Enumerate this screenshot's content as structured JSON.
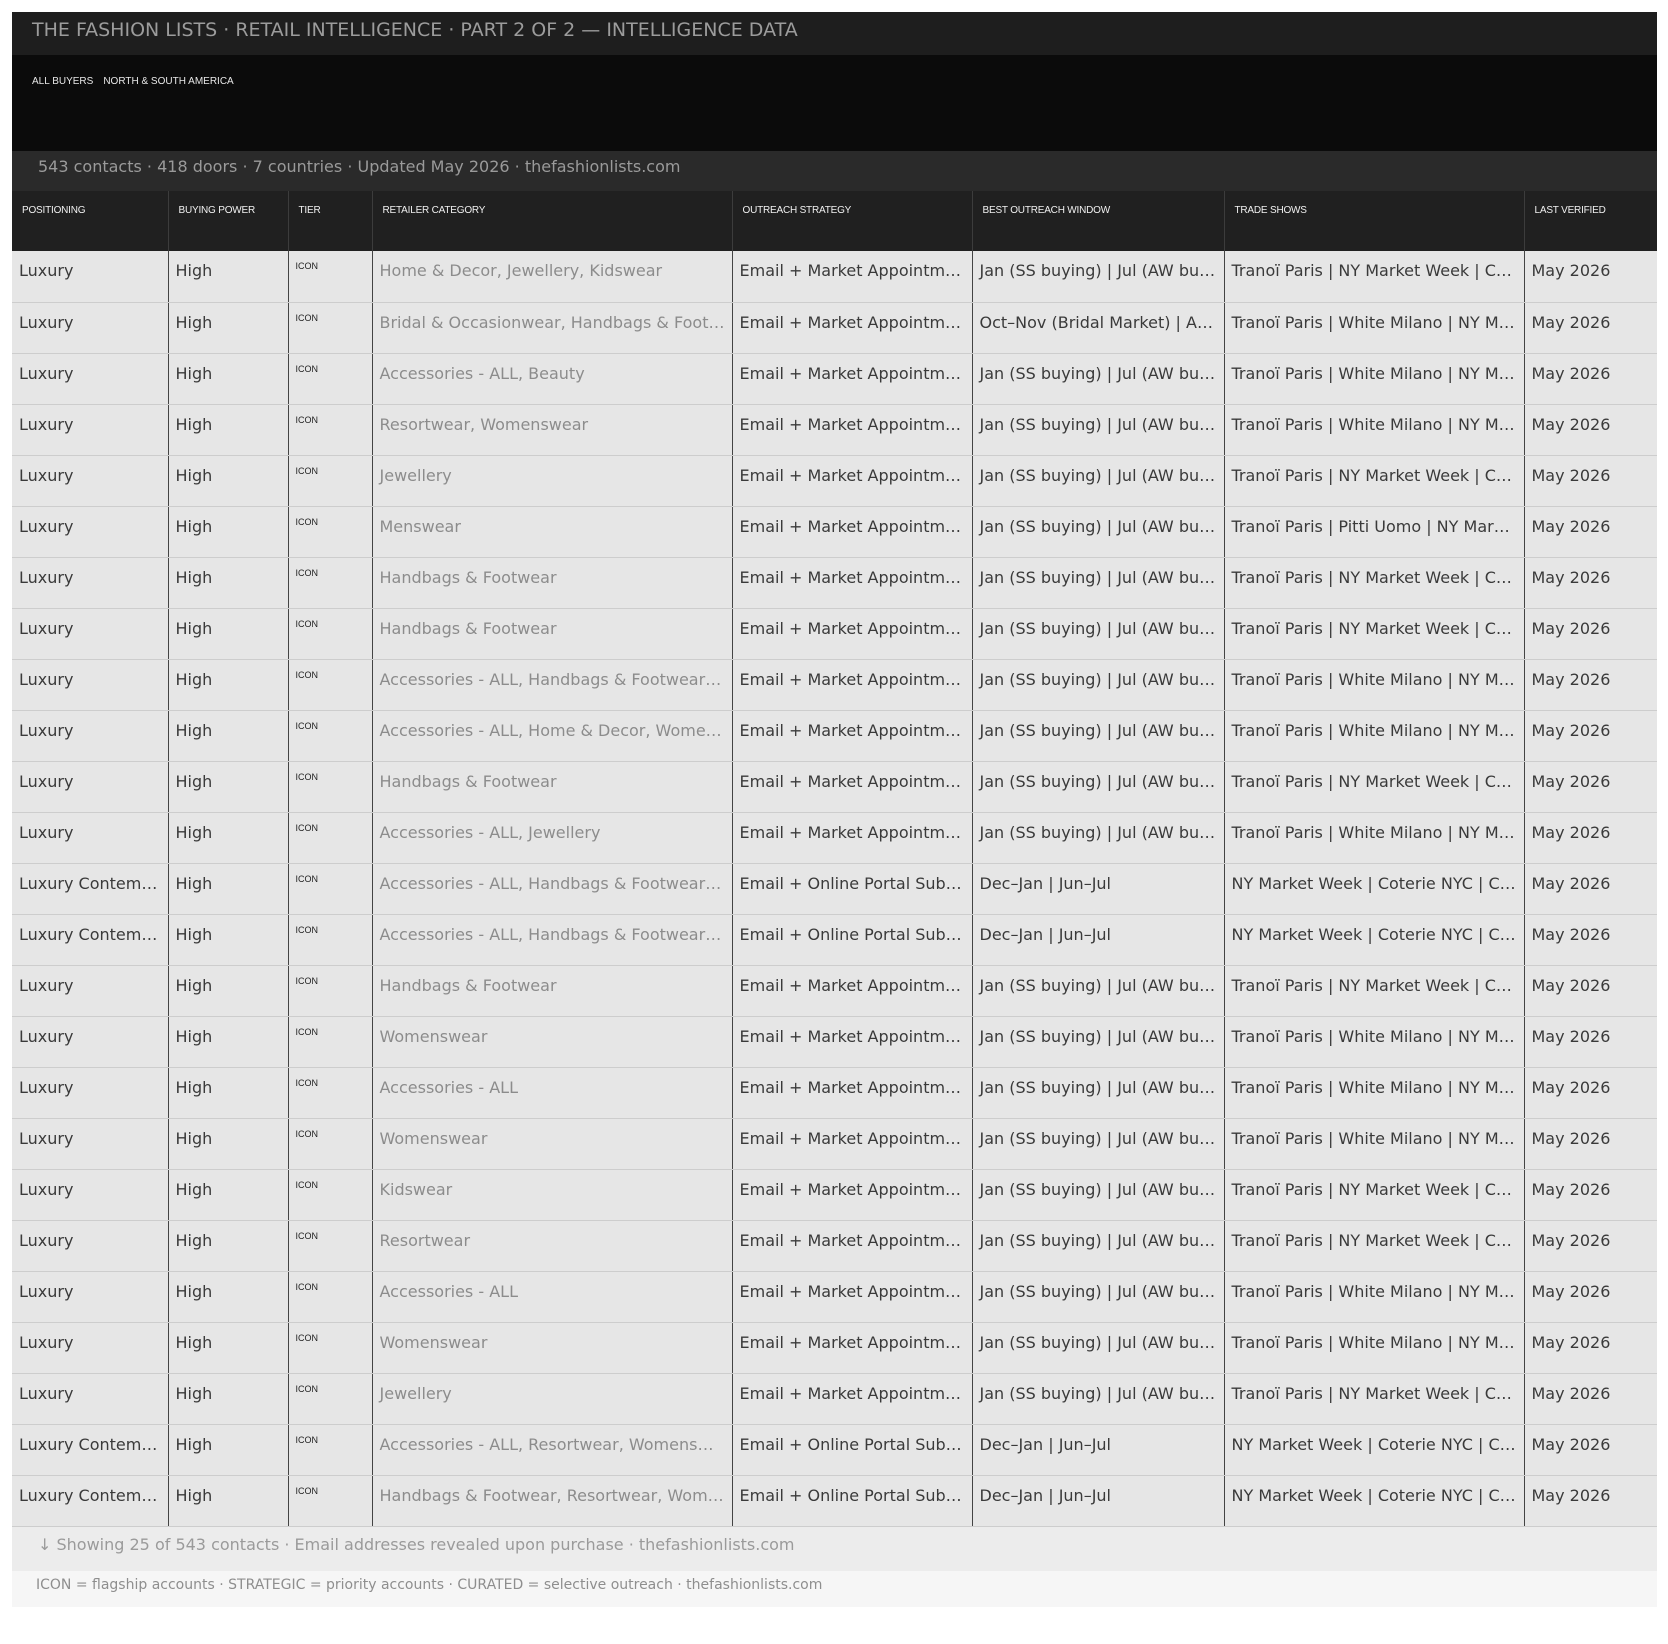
{
  "header": {
    "title": "THE FASHION LISTS  ·  RETAIL INTELLIGENCE  ·  PART 2 OF 2 — INTELLIGENCE DATA",
    "banner_label": "ALL BUYERS NORTH & SOUTH AMERICA",
    "stats": "543 contacts  ·  418 doors  ·  7 countries  ·  Updated May 2026  ·  thefashionlists.com"
  },
  "table": {
    "columns": [
      "Positioning",
      "Buying Power",
      "Tier",
      "Retailer Category",
      "Outreach Strategy",
      "Best Outreach Window",
      "Trade Shows",
      "Last Verified"
    ],
    "rows": [
      [
        "Luxury",
        "High",
        "ICON",
        "Home & Decor, Jewellery, Kidswear",
        "Email + Market Appointments",
        "Jan (SS buying) | Jul (AW buying)",
        "Tranoï Paris | NY Market Week | Coterie NYC",
        "May 2026"
      ],
      [
        "Luxury",
        "High",
        "ICON",
        "Bridal & Occasionwear, Handbags & Footwear",
        "Email + Market Appointments",
        "Oct–Nov (Bridal Market) | Apr–May",
        "Tranoï Paris | White Milano | NY Market Week",
        "May 2026"
      ],
      [
        "Luxury",
        "High",
        "ICON",
        "Accessories - ALL, Beauty",
        "Email + Market Appointments",
        "Jan (SS buying) | Jul (AW buying)",
        "Tranoï Paris | White Milano | NY Market Week",
        "May 2026"
      ],
      [
        "Luxury",
        "High",
        "ICON",
        "Resortwear, Womenswear",
        "Email + Market Appointments",
        "Jan (SS buying) | Jul (AW buying)",
        "Tranoï Paris | White Milano | NY Market Week",
        "May 2026"
      ],
      [
        "Luxury",
        "High",
        "ICON",
        "Jewellery",
        "Email + Market Appointments",
        "Jan (SS buying) | Jul (AW buying)",
        "Tranoï Paris | NY Market Week | Coterie NYC",
        "May 2026"
      ],
      [
        "Luxury",
        "High",
        "ICON",
        "Menswear",
        "Email + Market Appointments",
        "Jan (SS buying) | Jul (AW buying)",
        "Tranoï Paris | Pitti Uomo | NY Market Week",
        "May 2026"
      ],
      [
        "Luxury",
        "High",
        "ICON",
        "Handbags & Footwear",
        "Email + Market Appointments",
        "Jan (SS buying) | Jul (AW buying)",
        "Tranoï Paris | NY Market Week | Coterie NYC",
        "May 2026"
      ],
      [
        "Luxury",
        "High",
        "ICON",
        "Handbags & Footwear",
        "Email + Market Appointments",
        "Jan (SS buying) | Jul (AW buying)",
        "Tranoï Paris | NY Market Week | Coterie NYC",
        "May 2026"
      ],
      [
        "Luxury",
        "High",
        "ICON",
        "Accessories - ALL, Handbags & Footwear, Jewellery",
        "Email + Market Appointments",
        "Jan (SS buying) | Jul (AW buying)",
        "Tranoï Paris | White Milano | NY Market Week",
        "May 2026"
      ],
      [
        "Luxury",
        "High",
        "ICON",
        "Accessories - ALL, Home & Decor, Womenswear",
        "Email + Market Appointments",
        "Jan (SS buying) | Jul (AW buying)",
        "Tranoï Paris | White Milano | NY Market Week",
        "May 2026"
      ],
      [
        "Luxury",
        "High",
        "ICON",
        "Handbags & Footwear",
        "Email + Market Appointments",
        "Jan (SS buying) | Jul (AW buying)",
        "Tranoï Paris | NY Market Week | Coterie NYC",
        "May 2026"
      ],
      [
        "Luxury",
        "High",
        "ICON",
        "Accessories - ALL, Jewellery",
        "Email + Market Appointments",
        "Jan (SS buying) | Jul (AW buying)",
        "Tranoï Paris | White Milano | NY Market Week",
        "May 2026"
      ],
      [
        "Luxury Contemporary",
        "High",
        "ICON",
        "Accessories - ALL, Handbags & Footwear, Womenswear",
        "Email + Online Portal Submission",
        "Dec–Jan | Jun–Jul",
        "NY Market Week | Coterie NYC | Capsule",
        "May 2026"
      ],
      [
        "Luxury Contemporary",
        "High",
        "ICON",
        "Accessories - ALL, Handbags & Footwear, Jewellery",
        "Email + Online Portal Submission",
        "Dec–Jan | Jun–Jul",
        "NY Market Week | Coterie NYC | Capsule",
        "May 2026"
      ],
      [
        "Luxury",
        "High",
        "ICON",
        "Handbags & Footwear",
        "Email + Market Appointments",
        "Jan (SS buying) | Jul (AW buying)",
        "Tranoï Paris | NY Market Week | Coterie NYC",
        "May 2026"
      ],
      [
        "Luxury",
        "High",
        "ICON",
        "Womenswear",
        "Email + Market Appointments",
        "Jan (SS buying) | Jul (AW buying)",
        "Tranoï Paris | White Milano | NY Market Week",
        "May 2026"
      ],
      [
        "Luxury",
        "High",
        "ICON",
        "Accessories - ALL",
        "Email + Market Appointments",
        "Jan (SS buying) | Jul (AW buying)",
        "Tranoï Paris | White Milano | NY Market Week",
        "May 2026"
      ],
      [
        "Luxury",
        "High",
        "ICON",
        "Womenswear",
        "Email + Market Appointments",
        "Jan (SS buying) | Jul (AW buying)",
        "Tranoï Paris | White Milano | NY Market Week",
        "May 2026"
      ],
      [
        "Luxury",
        "High",
        "ICON",
        "Kidswear",
        "Email + Market Appointments",
        "Jan (SS buying) | Jul (AW buying)",
        "Tranoï Paris | NY Market Week | Coterie NYC",
        "May 2026"
      ],
      [
        "Luxury",
        "High",
        "ICON",
        "Resortwear",
        "Email + Market Appointments",
        "Jan (SS buying) | Jul (AW buying)",
        "Tranoï Paris | NY Market Week | Coterie NYC",
        "May 2026"
      ],
      [
        "Luxury",
        "High",
        "ICON",
        "Accessories - ALL",
        "Email + Market Appointments",
        "Jan (SS buying) | Jul (AW buying)",
        "Tranoï Paris | White Milano | NY Market Week",
        "May 2026"
      ],
      [
        "Luxury",
        "High",
        "ICON",
        "Womenswear",
        "Email + Market Appointments",
        "Jan (SS buying) | Jul (AW buying)",
        "Tranoï Paris | White Milano | NY Market Week",
        "May 2026"
      ],
      [
        "Luxury",
        "High",
        "ICON",
        "Jewellery",
        "Email + Market Appointments",
        "Jan (SS buying) | Jul (AW buying)",
        "Tranoï Paris | NY Market Week | Coterie NYC",
        "May 2026"
      ],
      [
        "Luxury Contemporary",
        "High",
        "ICON",
        "Accessories - ALL, Resortwear, Womenswear",
        "Email + Online Portal Submission",
        "Dec–Jan | Jun–Jul",
        "NY Market Week | Coterie NYC | Capsule",
        "May 2026"
      ],
      [
        "Luxury Contemporary",
        "High",
        "ICON",
        "Handbags & Footwear, Resortwear, Womenswear",
        "Email + Online Portal Submission",
        "Dec–Jan | Jun–Jul",
        "NY Market Week | Coterie NYC | Capsule",
        "May 2026"
      ]
    ]
  },
  "footer": {
    "showing": "↓  Showing 25 of 543 contacts  ·  Email addresses revealed upon purchase  ·  thefashionlists.com",
    "legend": "ICON = flagship accounts  ·  STRATEGIC = priority accounts  ·  CURATED = selective outreach  ·  thefashionlists.com"
  }
}
